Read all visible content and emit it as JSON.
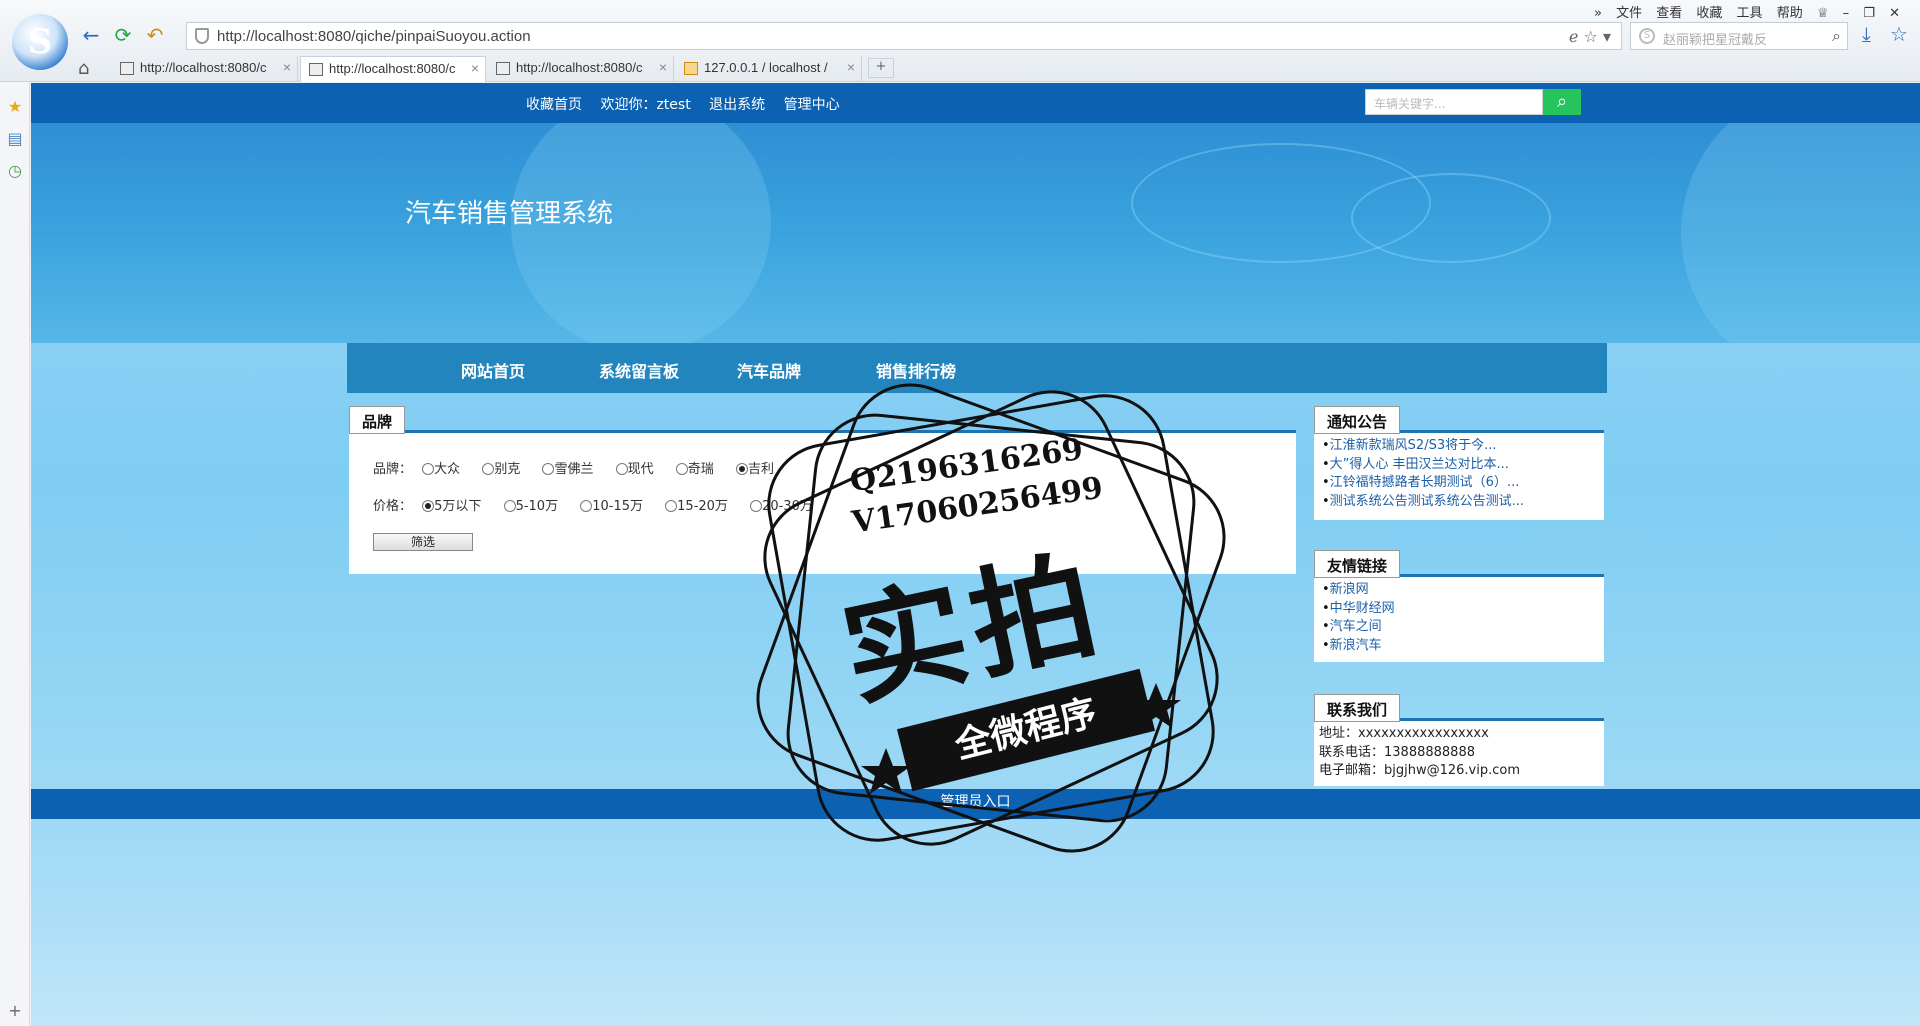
{
  "browser": {
    "url": "http://localhost:8080/qiche/pinpaiSuoyou.action",
    "search_placeholder": "赵丽颖把星冠戴反",
    "menu": [
      "文件",
      "查看",
      "收藏",
      "工具",
      "帮助"
    ],
    "tabs": [
      {
        "label": "http://localhost:8080/c"
      },
      {
        "label": "http://localhost:8080/c"
      },
      {
        "label": "http://localhost:8080/c"
      },
      {
        "label": "127.0.0.1 / localhost /"
      }
    ],
    "new_tab": "+"
  },
  "header": {
    "links": [
      "收藏首页",
      "欢迎你：ztest",
      "退出系统",
      "管理中心"
    ],
    "search_placeholder": "车辆关键字..."
  },
  "site_title": "汽车销售管理系统",
  "nav": [
    "网站首页",
    "系统留言板",
    "汽车品牌",
    "销售排行榜"
  ],
  "brand_panel": {
    "tab": "品牌",
    "brand_label": "品牌：",
    "brands": [
      "大众",
      "别克",
      "雪佛兰",
      "现代",
      "奇瑞",
      "吉利"
    ],
    "brand_selected": "吉利",
    "price_label": "价格：",
    "prices": [
      "5万以下",
      "5-10万",
      "10-15万",
      "15-20万",
      "20-30万"
    ],
    "price_selected": "5万以下",
    "filter_button": "筛选"
  },
  "notice": {
    "title": "通知公告",
    "items": [
      "江淮新款瑞风S2/S3将于今...",
      "大”得人心 丰田汉兰达对比本...",
      "江铃福特撼路者长期测试（6）...",
      "测试系统公告测试系统公告测试..."
    ]
  },
  "friend_links": {
    "title": "友情链接",
    "items": [
      "新浪网",
      "中华财经网",
      "汽车之间",
      "新浪汽车"
    ]
  },
  "contact": {
    "title": "联系我们",
    "address": "地址：xxxxxxxxxxxxxxxxx",
    "phone": "联系电话：13888888888",
    "email": "电子邮箱：bjgjhw@126.vip.com"
  },
  "footer": {
    "admin_link": "管理员入口"
  },
  "watermark": {
    "line1": "Q2196316269",
    "line2": "V17060256499",
    "big": "实拍",
    "ribbon": "全微程序"
  }
}
